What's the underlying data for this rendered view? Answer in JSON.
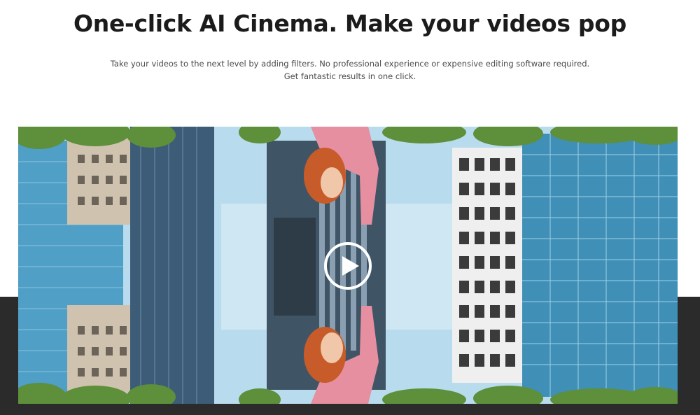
{
  "hero": {
    "title": "One-click AI Cinema. Make your videos pop",
    "subtitle_line1": "Take your videos to the next level by adding filters. No professional experience or expensive editing software required.",
    "subtitle_line2": "Get fantastic results in one click."
  },
  "video": {
    "play_icon": "play-icon",
    "description": "Mirrored city skyline with woman in pink shirt"
  },
  "colors": {
    "dark_band": "#2b2b2c",
    "sky": "#a9d0e8",
    "glass": "#4f9fc6",
    "shirt": "#e58fa0",
    "hair": "#c85b2a",
    "trees": "#5e8f3a"
  }
}
